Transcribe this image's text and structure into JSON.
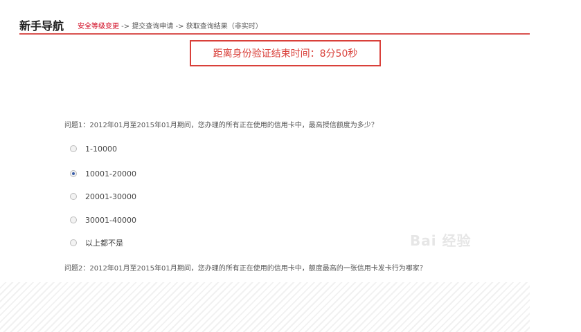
{
  "nav": {
    "title": "新手导航",
    "step1": "安全等级变更",
    "sep1": " -> ",
    "step2": "提交查询申请",
    "sep2": " -> ",
    "step3": "获取查询结果（非实时）"
  },
  "timer": "距离身份验证结束时间：8分50秒",
  "question1": {
    "text": "问题1：2012年01月至2015年01月期间，您办理的所有正在使用的信用卡中，最高授信额度为多少？",
    "options": [
      "1-10000",
      "10001-20000",
      "20001-30000",
      "30001-40000",
      "以上都不是"
    ],
    "selected": "10001-20000"
  },
  "question2": {
    "text": "问题2：2012年01月至2015年01月期间，您办理的所有正在使用的信用卡中，额度最高的一张信用卡发卡行为哪家？"
  },
  "watermark": "Bai 经验"
}
